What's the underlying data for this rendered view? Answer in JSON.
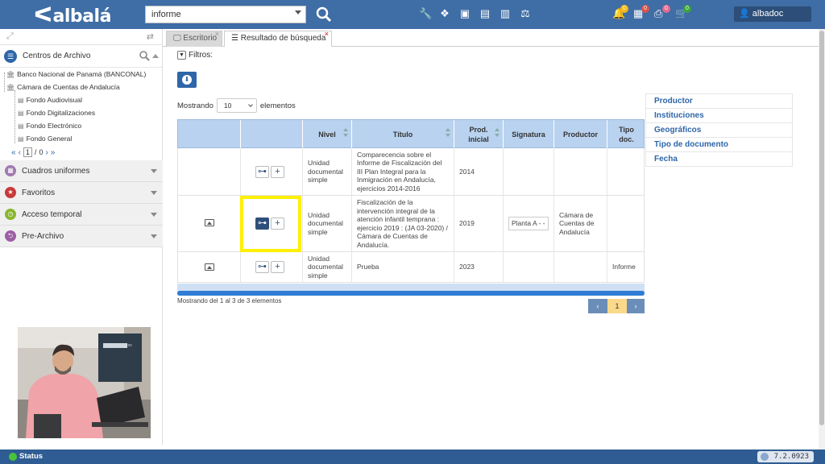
{
  "app": {
    "logo": "albalá",
    "user": "albadoc",
    "version": "7.2.0923"
  },
  "search": {
    "value": "informe"
  },
  "notifications": [
    {
      "icon": "bell-icon",
      "count": "0",
      "color": "#f3b81d"
    },
    {
      "icon": "calendar-icon",
      "count": "0",
      "color": "#d9534f"
    },
    {
      "icon": "printer-icon",
      "count": "0",
      "color": "#e46a8d"
    },
    {
      "icon": "cart-icon",
      "count": "0",
      "color": "#3aa63a"
    }
  ],
  "left": {
    "centros_label": "Centros de Archivo",
    "tree": [
      "Banco Nacional de Panamá (BANCONAL)",
      "Cámara de Cuentas de Andalucía",
      "Fondo Audiovisual",
      "Fondo Digitalizaciones",
      "Fondo Electrónico",
      "Fondo General"
    ],
    "pager": {
      "page": "1",
      "total": "0"
    },
    "sections": [
      {
        "label": "Cuadros uniformes",
        "color": "#a07ab0",
        "icon": "grid-icon"
      },
      {
        "label": "Favoritos",
        "color": "#c93a3a",
        "icon": "star-icon"
      },
      {
        "label": "Acceso temporal",
        "color": "#8ab52f",
        "icon": "clock-icon"
      },
      {
        "label": "Pre-Archivo",
        "color": "#9c5fa4",
        "icon": "pre-archive-icon"
      }
    ]
  },
  "tabs": [
    {
      "label": "Escritorio"
    },
    {
      "label": "Resultado de búsqueda"
    }
  ],
  "main": {
    "filtros_label": "Filtros:",
    "mostrando_prefix": "Mostrando",
    "page_size": "10",
    "mostrando_suffix": "elementos",
    "columns": [
      "Nivel",
      "Título",
      "Prod. inicial",
      "Signatura",
      "Productor",
      "Tipo doc."
    ],
    "rows": [
      {
        "nivel": "Unidad documental simple",
        "titulo": "Comparecencia sobre el Informe de Fiscalización del III Plan Integral para la Inmigración en Andalucía, ejercicios 2014-2016",
        "prod": "2014",
        "signatura": "",
        "productor": "",
        "tipo": ""
      },
      {
        "nivel": "Unidad documental simple",
        "titulo": "Fiscalización de la intervención integral de la atención infantil temprana : ejercicio 2019 : (JA 03-2020) / Cámara de Cuentas de Andalucía.",
        "prod": "2019",
        "signatura": "Planta A - -",
        "productor": "Cámara de Cuentas de Andalucía",
        "tipo": ""
      },
      {
        "nivel": "Unidad documental simple",
        "titulo": "Prueba",
        "prod": "2023",
        "signatura": "",
        "productor": "",
        "tipo": "Informe"
      }
    ],
    "footer": "Mostrando del 1 al 3 de 3 elementos",
    "current_page": "1"
  },
  "filters_panel": [
    "Productor",
    "Instituciones",
    "Geográficos",
    "Tipo de documento",
    "Fecha"
  ],
  "status": {
    "label": "Status"
  },
  "colors": {
    "topbar": "#3f6da5",
    "accent": "#2e66a8",
    "highlight": "#ffef00"
  }
}
